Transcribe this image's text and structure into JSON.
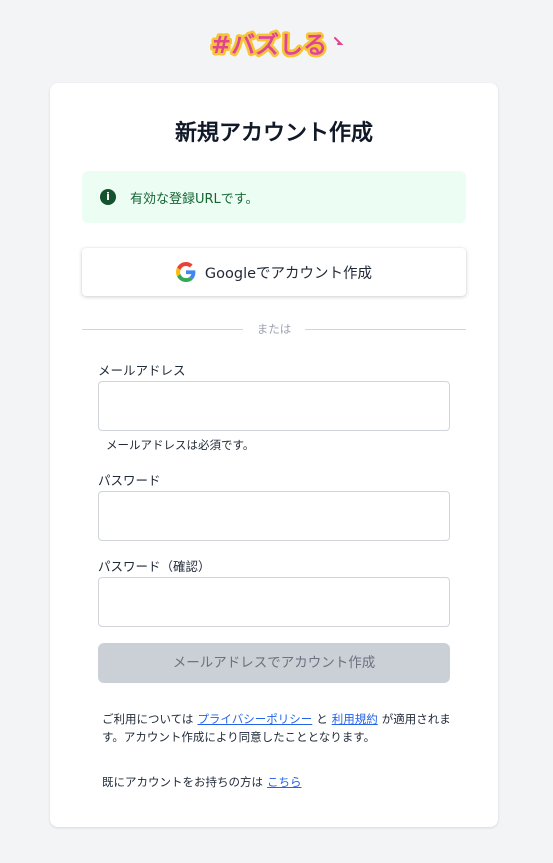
{
  "logo": {
    "text": "#バズしる"
  },
  "card": {
    "title": "新規アカウント作成",
    "alert": {
      "text": "有効な登録URLです。"
    },
    "google_button": {
      "label": "Googleでアカウント作成"
    },
    "divider_text": "または",
    "email": {
      "label": "メールアドレス",
      "value": "",
      "helper": "メールアドレスは必須です。"
    },
    "password": {
      "label": "パスワード",
      "value": ""
    },
    "password_confirm": {
      "label": "パスワード（確認）",
      "value": ""
    },
    "submit_button": {
      "label": "メールアドレスでアカウント作成"
    },
    "terms": {
      "prefix": "ご利用については",
      "privacy_link": "プライバシーポリシー",
      "and": "と",
      "terms_link": "利用規約",
      "suffix": "が適用されます。アカウント作成により同意したこととなります。"
    },
    "login": {
      "prefix": "既にアカウントをお持ちの方は",
      "link": "こちら"
    }
  },
  "colors": {
    "background": "#f3f4f6",
    "alert_bg": "#ecfdf3",
    "alert_text": "#166534",
    "link": "#2563eb",
    "disabled_button": "#cbd0d6"
  }
}
